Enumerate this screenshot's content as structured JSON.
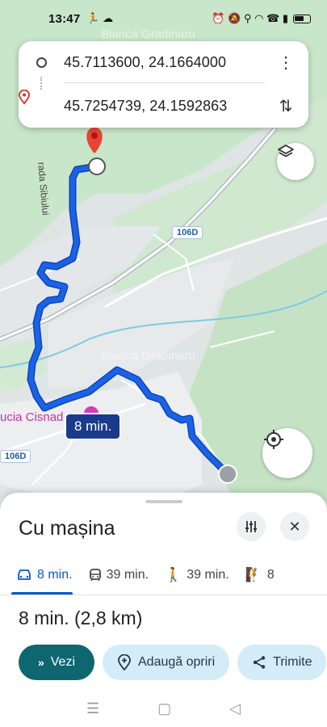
{
  "status_bar": {
    "time": "13:47",
    "left_icons": "🏃 ☁",
    "right_icons": "⏰ 🔕 ⚲ ◠ ☎ ▮"
  },
  "watermark": "Bianca Gradinaru",
  "route": {
    "origin": "45.7113600, 24.1664000",
    "destination": "45.7254739, 24.1592863",
    "more_icon": "more-vert-icon",
    "swap_icon": "swap-icon"
  },
  "map": {
    "duration_label": "8 min.",
    "place_label": "ucia Cisnad",
    "road_badge_1": "106D",
    "road_badge_2": "106D",
    "street_label": "rada Sibiului",
    "route_color": "#1a62e8"
  },
  "sheet": {
    "title": "Cu mașina",
    "modes": [
      {
        "icon": "car-icon",
        "label": "8 min.",
        "active": true
      },
      {
        "icon": "transit-icon",
        "label": "39 min.",
        "active": false
      },
      {
        "icon": "walk-icon",
        "label": "39 min.",
        "active": false
      },
      {
        "icon": "bike-icon",
        "label": "8",
        "active": false
      }
    ],
    "summary": "8 min. (2,8 km)",
    "actions": {
      "view": "Vezi",
      "add_stops": "Adaugă opriri",
      "share": "Trimite"
    }
  },
  "colors": {
    "accent": "#0b57d0",
    "primary_button": "#0e6670",
    "secondary_button": "#d3ecf7"
  }
}
